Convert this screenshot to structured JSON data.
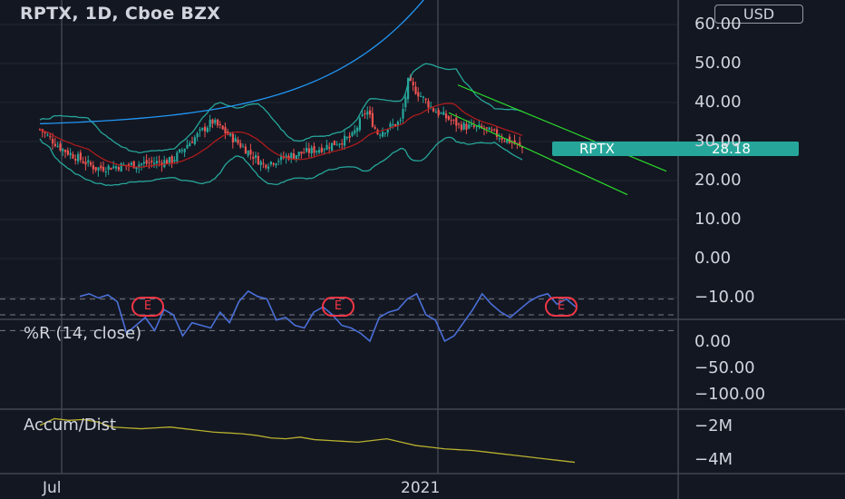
{
  "header": {
    "title": "RPTX, 1D, Cboe BZX",
    "currency": "USD"
  },
  "price_badge": {
    "symbol": "RPTX",
    "value": "28.18"
  },
  "earnings_markers": [
    "E",
    "E",
    "E"
  ],
  "indicators": {
    "williams_r": {
      "title": "%R (14, close)"
    },
    "accum_dist": {
      "title": "Accum/Dist"
    }
  },
  "colors": {
    "background": "#131722",
    "up": "#26a69a",
    "down": "#ef5350",
    "envelope": "#2196f3",
    "bollinger": "#26a69a",
    "basis": "#b71c1c",
    "channel": "#2bd92b",
    "williams": "#4a6fd8",
    "ad": "#b8b02e",
    "earnings": "#f23645"
  },
  "chart_data": [
    {
      "type": "candlestick",
      "title": "RPTX, 1D, Cboe BZX",
      "y_ticks": [
        "60.00",
        "50.00",
        "40.00",
        "30.00",
        "20.00",
        "10.00",
        "0.00",
        "−10.00"
      ],
      "x_ticks": [
        "Jul",
        "2021"
      ],
      "ylim": [
        -12,
        62
      ],
      "last_price": 28.18,
      "approx_close_path": [
        {
          "date": "2020-06-19",
          "value": 33
        },
        {
          "date": "2020-07-01",
          "value": 28
        },
        {
          "date": "2020-07-20",
          "value": 23
        },
        {
          "date": "2020-08-10",
          "value": 24
        },
        {
          "date": "2020-08-31",
          "value": 25
        },
        {
          "date": "2020-09-08",
          "value": 29
        },
        {
          "date": "2020-09-22",
          "value": 35
        },
        {
          "date": "2020-10-05",
          "value": 30
        },
        {
          "date": "2020-10-20",
          "value": 24
        },
        {
          "date": "2020-11-02",
          "value": 26
        },
        {
          "date": "2020-11-20",
          "value": 28
        },
        {
          "date": "2020-12-08",
          "value": 31
        },
        {
          "date": "2020-12-16",
          "value": 38
        },
        {
          "date": "2020-12-22",
          "value": 32
        },
        {
          "date": "2021-01-04",
          "value": 35
        },
        {
          "date": "2021-01-08",
          "value": 45
        },
        {
          "date": "2021-01-22",
          "value": 38
        },
        {
          "date": "2021-02-05",
          "value": 34
        },
        {
          "date": "2021-02-19",
          "value": 33
        },
        {
          "date": "2021-03-05",
          "value": 30
        },
        {
          "date": "2021-03-12",
          "value": 28.18
        }
      ]
    },
    {
      "type": "line",
      "title": "%R (14, close)",
      "y_ticks": [
        "0.00",
        "−50.00",
        "−100.00"
      ],
      "ylim": [
        -105,
        5
      ],
      "band": [
        -80,
        -20
      ],
      "approx_values": [
        -85,
        -90,
        -82,
        -88,
        -75,
        -15,
        -30,
        -45,
        -20,
        -60,
        -50,
        -10,
        -35,
        -30,
        -25,
        -55,
        -35,
        -75,
        -95,
        -85,
        -80,
        -40,
        -45,
        -30,
        -25,
        -55,
        -65,
        -50,
        -30,
        -25,
        -15,
        0,
        -45,
        -55,
        -60,
        -80,
        -90,
        -50,
        -40,
        0,
        -10,
        -35,
        -60,
        -90,
        -70,
        -55,
        -45,
        -60,
        -75,
        -85,
        -90,
        -70,
        -80,
        -65
      ]
    },
    {
      "type": "line",
      "title": "Accum/Dist",
      "y_ticks": [
        "−2M",
        "−4M"
      ],
      "ylim": [
        -4.6,
        -1.4
      ],
      "approx_values": [
        -2.1,
        -1.7,
        -1.8,
        -1.75,
        -1.9,
        -2.2,
        -2.25,
        -2.3,
        -2.25,
        -2.2,
        -2.3,
        -2.4,
        -2.5,
        -2.55,
        -2.6,
        -2.7,
        -2.85,
        -2.9,
        -2.8,
        -2.95,
        -3.0,
        -3.05,
        -3.1,
        -3.0,
        -2.9,
        -3.1,
        -3.3,
        -3.4,
        -3.5,
        -3.55,
        -3.6,
        -3.7,
        -3.8,
        -3.9,
        -4.0,
        -4.1,
        -4.2,
        -4.3
      ]
    }
  ]
}
